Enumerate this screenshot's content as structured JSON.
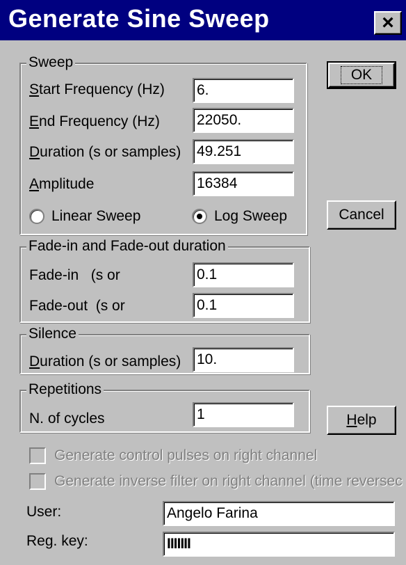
{
  "window": {
    "title": "Generate Sine Sweep",
    "close_label": "×"
  },
  "sweep": {
    "title": "Sweep",
    "start_frequency": {
      "label": "Start Frequency (Hz)",
      "value": "6."
    },
    "end_frequency": {
      "label": "End Frequency (Hz)",
      "value": "22050."
    },
    "duration": {
      "label": "Duration (s or samples)",
      "value": "49.251"
    },
    "amplitude": {
      "label": "Amplitude",
      "value": "16384"
    },
    "linear_sweep": {
      "label": "Linear Sweep",
      "selected": false
    },
    "log_sweep": {
      "label": "Log Sweep",
      "selected": true
    }
  },
  "fade": {
    "title": "Fade-in and Fade-out duration",
    "fade_in": {
      "label": "Fade-in   (s or",
      "value": "0.1"
    },
    "fade_out": {
      "label": "Fade-out  (s or",
      "value": "0.1"
    }
  },
  "silence": {
    "title": "Silence",
    "duration": {
      "label": "Duration (s or samples)",
      "value": "10."
    }
  },
  "repetitions": {
    "title": "Repetitions",
    "cycles": {
      "label": "N. of cycles",
      "value": "1"
    }
  },
  "buttons": {
    "ok": "OK",
    "cancel": "Cancel",
    "help": "Help"
  },
  "options": {
    "control_pulses": {
      "label": "Generate control pulses on right channel",
      "checked": false,
      "enabled": false
    },
    "inverse_filter": {
      "label": "Generate inverse filter on right channel (time reversec",
      "checked": false,
      "enabled": false
    }
  },
  "registration": {
    "user": {
      "label": "User:",
      "value": "Angelo Farina"
    },
    "reg_key": {
      "label": "Reg. key:",
      "value": "IIIIIII"
    }
  },
  "colors": {
    "title_bar": "#000080",
    "dialog_bg": "#c0c0c0",
    "field_bg": "#ffffff",
    "disabled_text": "#808080"
  }
}
